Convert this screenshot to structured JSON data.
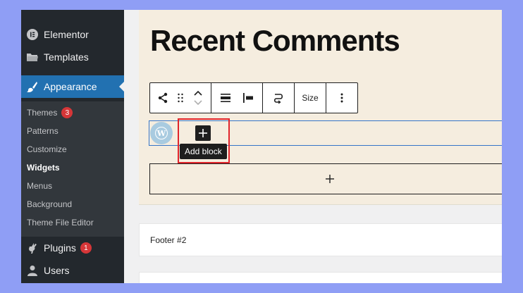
{
  "sidebar": {
    "menu_top": [
      {
        "label": "Elementor",
        "icon": "elementor-icon"
      },
      {
        "label": "Templates",
        "icon": "folder-icon"
      },
      {
        "label": "Appearance",
        "icon": "paintbrush-icon"
      }
    ],
    "appearance_sub": [
      {
        "label": "Themes",
        "badge": "3"
      },
      {
        "label": "Patterns"
      },
      {
        "label": "Customize"
      },
      {
        "label": "Widgets"
      },
      {
        "label": "Menus"
      },
      {
        "label": "Background"
      },
      {
        "label": "Theme File Editor"
      }
    ],
    "menu_bottom": [
      {
        "label": "Plugins",
        "icon": "plug-icon",
        "badge": "1"
      },
      {
        "label": "Users",
        "icon": "user-icon"
      }
    ]
  },
  "editor": {
    "heading": "Recent Comments",
    "toolbar": {
      "size_label": "Size"
    },
    "tooltip": "Add block",
    "footer_card_title": "Footer #2"
  },
  "colors": {
    "sidebar_bg": "#23282d",
    "submenu_bg": "#32373c",
    "accent": "#2271b1",
    "badge": "#d63638",
    "widget_bg": "#f5eddf",
    "highlight": "#e0242b",
    "page_bg": "#8f9ef5"
  }
}
